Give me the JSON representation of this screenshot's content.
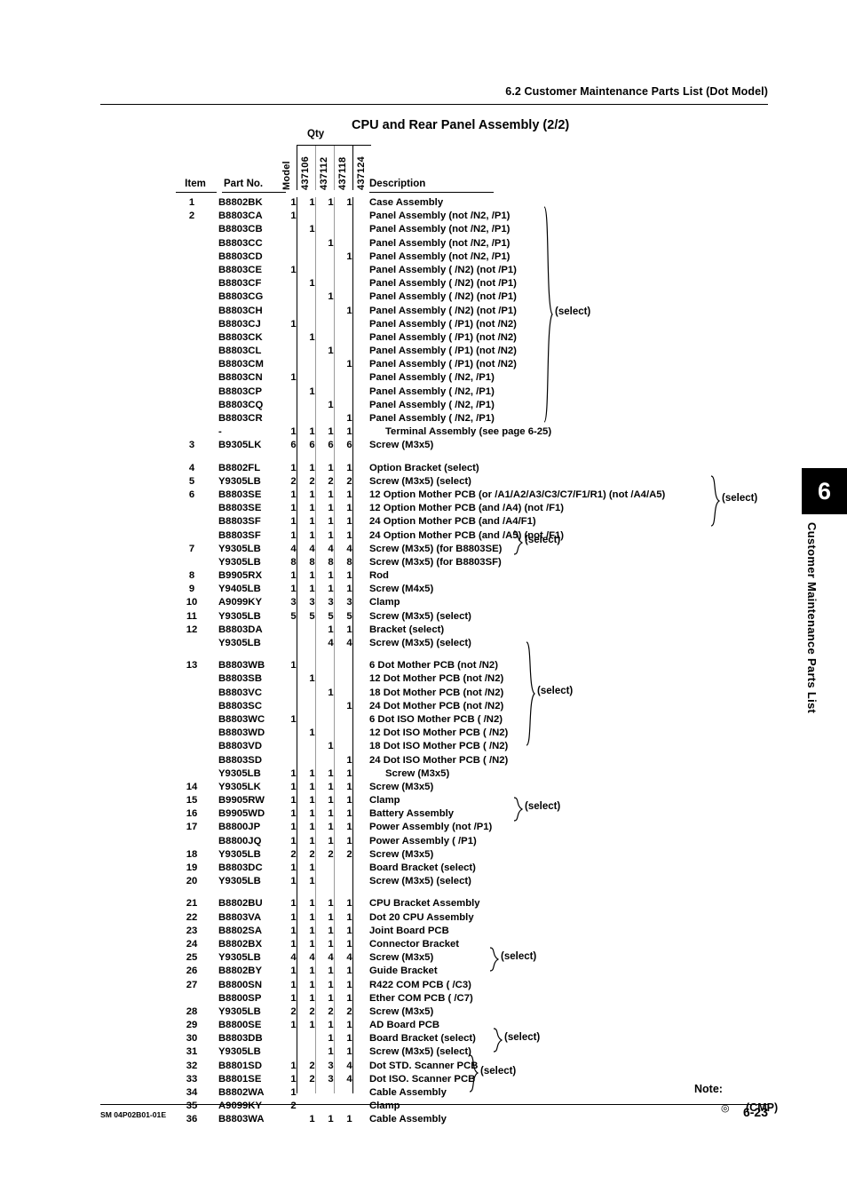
{
  "header": {
    "running_head": "6.2  Customer Maintenance Parts List (Dot Model)"
  },
  "figure": {
    "title": "CPU and Rear Panel Assembly (2/2)",
    "qty_label": "Qty"
  },
  "table": {
    "columns": {
      "item": "Item",
      "part_no": "Part  No.",
      "description": "Description",
      "model_label": "Model",
      "models": [
        "437106",
        "437112",
        "437118",
        "437124"
      ]
    },
    "rows": [
      {
        "item": "1",
        "part": "B8802BK",
        "q": [
          "1",
          "1",
          "1",
          "1"
        ],
        "desc": "Case Assembly"
      },
      {
        "item": "2",
        "part": "B8803CA",
        "q": [
          "1",
          "",
          "",
          ""
        ],
        "desc": "Panel Assembly (not /N2, /P1)"
      },
      {
        "item": "",
        "part": "B8803CB",
        "q": [
          "",
          "1",
          "",
          ""
        ],
        "desc": "Panel Assembly (not /N2, /P1)"
      },
      {
        "item": "",
        "part": "B8803CC",
        "q": [
          "",
          "",
          "1",
          ""
        ],
        "desc": "Panel Assembly (not /N2, /P1)"
      },
      {
        "item": "",
        "part": "B8803CD",
        "q": [
          "",
          "",
          "",
          "1"
        ],
        "desc": "Panel Assembly (not /N2, /P1)"
      },
      {
        "item": "",
        "part": "B8803CE",
        "q": [
          "1",
          "",
          "",
          ""
        ],
        "desc": "Panel Assembly ( /N2) (not /P1)"
      },
      {
        "item": "",
        "part": "B8803CF",
        "q": [
          "",
          "1",
          "",
          ""
        ],
        "desc": "Panel Assembly ( /N2) (not /P1)"
      },
      {
        "item": "",
        "part": "B8803CG",
        "q": [
          "",
          "",
          "1",
          ""
        ],
        "desc": "Panel Assembly ( /N2) (not /P1)"
      },
      {
        "item": "",
        "part": "B8803CH",
        "q": [
          "",
          "",
          "",
          "1"
        ],
        "desc": "Panel Assembly ( /N2) (not /P1)"
      },
      {
        "item": "",
        "part": "B8803CJ",
        "q": [
          "1",
          "",
          "",
          ""
        ],
        "desc": "Panel Assembly ( /P1) (not /N2)"
      },
      {
        "item": "",
        "part": "B8803CK",
        "q": [
          "",
          "1",
          "",
          ""
        ],
        "desc": "Panel Assembly ( /P1) (not /N2)"
      },
      {
        "item": "",
        "part": "B8803CL",
        "q": [
          "",
          "",
          "1",
          ""
        ],
        "desc": "Panel Assembly ( /P1) (not /N2)"
      },
      {
        "item": "",
        "part": "B8803CM",
        "q": [
          "",
          "",
          "",
          "1"
        ],
        "desc": "Panel Assembly ( /P1) (not /N2)"
      },
      {
        "item": "",
        "part": "B8803CN",
        "q": [
          "1",
          "",
          "",
          ""
        ],
        "desc": "Panel Assembly ( /N2, /P1)"
      },
      {
        "item": "",
        "part": "B8803CP",
        "q": [
          "",
          "1",
          "",
          ""
        ],
        "desc": "Panel Assembly ( /N2, /P1)"
      },
      {
        "item": "",
        "part": "B8803CQ",
        "q": [
          "",
          "",
          "1",
          ""
        ],
        "desc": "Panel Assembly ( /N2, /P1)"
      },
      {
        "item": "",
        "part": "B8803CR",
        "q": [
          "",
          "",
          "",
          "1"
        ],
        "desc": "Panel Assembly ( /N2, /P1)"
      },
      {
        "item": "",
        "part": "-",
        "q": [
          "1",
          "1",
          "1",
          "1"
        ],
        "desc": "Terminal Assembly (see page 6-25)",
        "indent": true
      },
      {
        "item": "3",
        "part": "B9305LK",
        "q": [
          "6",
          "6",
          "6",
          "6"
        ],
        "desc": "Screw (M3x5)"
      },
      {
        "spacer": true
      },
      {
        "item": "4",
        "part": "B8802FL",
        "q": [
          "1",
          "1",
          "1",
          "1"
        ],
        "desc": "Option Bracket (select)"
      },
      {
        "item": "5",
        "part": "Y9305LB",
        "q": [
          "2",
          "2",
          "2",
          "2"
        ],
        "desc": "Screw (M3x5) (select)"
      },
      {
        "item": "6",
        "part": "B8803SE",
        "q": [
          "1",
          "1",
          "1",
          "1"
        ],
        "desc": "12 Option Mother PCB (or /A1/A2/A3/C3/C7/F1/R1) (not /A4/A5)"
      },
      {
        "item": "",
        "part": "B8803SE",
        "q": [
          "1",
          "1",
          "1",
          "1"
        ],
        "desc": "12 Option Mother PCB (and /A4) (not /F1)"
      },
      {
        "item": "",
        "part": "B8803SF",
        "q": [
          "1",
          "1",
          "1",
          "1"
        ],
        "desc": "24 Option Mother PCB (and /A4/F1)"
      },
      {
        "item": "",
        "part": "B8803SF",
        "q": [
          "1",
          "1",
          "1",
          "1"
        ],
        "desc": "24 Option Mother PCB (and /A5) (not /F1)"
      },
      {
        "item": "7",
        "part": "Y9305LB",
        "q": [
          "4",
          "4",
          "4",
          "4"
        ],
        "desc": "Screw (M3x5) (for B8803SE)"
      },
      {
        "item": "",
        "part": "Y9305LB",
        "q": [
          "8",
          "8",
          "8",
          "8"
        ],
        "desc": "Screw (M3x5) (for B8803SF)"
      },
      {
        "item": "8",
        "part": "B9905RX",
        "q": [
          "1",
          "1",
          "1",
          "1"
        ],
        "desc": "Rod"
      },
      {
        "item": "9",
        "part": "Y9405LB",
        "q": [
          "1",
          "1",
          "1",
          "1"
        ],
        "desc": "Screw (M4x5)"
      },
      {
        "item": "10",
        "part": "A9099KY",
        "q": [
          "3",
          "3",
          "3",
          "3"
        ],
        "desc": "Clamp"
      },
      {
        "item": "11",
        "part": "Y9305LB",
        "q": [
          "5",
          "5",
          "5",
          "5"
        ],
        "desc": "Screw (M3x5) (select)"
      },
      {
        "item": "12",
        "part": "B8803DA",
        "q": [
          "",
          "",
          "1",
          "1"
        ],
        "desc": "Bracket (select)"
      },
      {
        "item": "",
        "part": "Y9305LB",
        "q": [
          "",
          "",
          "4",
          "4"
        ],
        "desc": "Screw (M3x5) (select)"
      },
      {
        "spacer": true
      },
      {
        "item": "13",
        "part": "B8803WB",
        "q": [
          "1",
          "",
          "",
          ""
        ],
        "desc": "6 Dot Mother PCB (not /N2)"
      },
      {
        "item": "",
        "part": "B8803SB",
        "q": [
          "",
          "1",
          "",
          ""
        ],
        "desc": "12 Dot Mother PCB (not /N2)"
      },
      {
        "item": "",
        "part": "B8803VC",
        "q": [
          "",
          "",
          "1",
          ""
        ],
        "desc": "18 Dot Mother PCB (not /N2)"
      },
      {
        "item": "",
        "part": "B8803SC",
        "q": [
          "",
          "",
          "",
          "1"
        ],
        "desc": "24 Dot Mother PCB (not /N2)"
      },
      {
        "item": "",
        "part": "B8803WC",
        "q": [
          "1",
          "",
          "",
          ""
        ],
        "desc": "6 Dot ISO Mother PCB ( /N2)"
      },
      {
        "item": "",
        "part": "B8803WD",
        "q": [
          "",
          "1",
          "",
          ""
        ],
        "desc": "12 Dot ISO Mother PCB ( /N2)"
      },
      {
        "item": "",
        "part": "B8803VD",
        "q": [
          "",
          "",
          "1",
          ""
        ],
        "desc": "18 Dot ISO Mother PCB ( /N2)"
      },
      {
        "item": "",
        "part": "B8803SD",
        "q": [
          "",
          "",
          "",
          "1"
        ],
        "desc": "24 Dot ISO Mother PCB ( /N2)"
      },
      {
        "item": "",
        "part": "Y9305LB",
        "q": [
          "1",
          "1",
          "1",
          "1"
        ],
        "desc": "Screw (M3x5)",
        "indent": true
      },
      {
        "item": "14",
        "part": "Y9305LK",
        "q": [
          "1",
          "1",
          "1",
          "1"
        ],
        "desc": "Screw (M3x5)"
      },
      {
        "item": "15",
        "part": "B9905RW",
        "q": [
          "1",
          "1",
          "1",
          "1"
        ],
        "desc": "Clamp"
      },
      {
        "item": "16",
        "part": "B9905WD",
        "q": [
          "1",
          "1",
          "1",
          "1"
        ],
        "desc": "Battery Assembly"
      },
      {
        "item": "17",
        "part": "B8800JP",
        "q": [
          "1",
          "1",
          "1",
          "1"
        ],
        "desc": "Power Assembly (not /P1)"
      },
      {
        "item": "",
        "part": "B8800JQ",
        "q": [
          "1",
          "1",
          "1",
          "1"
        ],
        "desc": "Power Assembly ( /P1)"
      },
      {
        "item": "18",
        "part": "Y9305LB",
        "q": [
          "2",
          "2",
          "2",
          "2"
        ],
        "desc": "Screw (M3x5)"
      },
      {
        "item": "19",
        "part": "B8803DC",
        "q": [
          "1",
          "1",
          "",
          ""
        ],
        "desc": "Board Bracket (select)"
      },
      {
        "item": "20",
        "part": "Y9305LB",
        "q": [
          "1",
          "1",
          "",
          ""
        ],
        "desc": "Screw (M3x5) (select)"
      },
      {
        "spacer": true
      },
      {
        "item": "21",
        "part": "B8802BU",
        "q": [
          "1",
          "1",
          "1",
          "1"
        ],
        "desc": "CPU Bracket Assembly"
      },
      {
        "item": "22",
        "part": "B8803VA",
        "q": [
          "1",
          "1",
          "1",
          "1"
        ],
        "desc": "Dot 20 CPU Assembly"
      },
      {
        "item": "23",
        "part": "B8802SA",
        "q": [
          "1",
          "1",
          "1",
          "1"
        ],
        "desc": "Joint Board PCB"
      },
      {
        "item": "24",
        "part": "B8802BX",
        "q": [
          "1",
          "1",
          "1",
          "1"
        ],
        "desc": "Connector Bracket"
      },
      {
        "item": "25",
        "part": "Y9305LB",
        "q": [
          "4",
          "4",
          "4",
          "4"
        ],
        "desc": "Screw (M3x5)"
      },
      {
        "item": "26",
        "part": "B8802BY",
        "q": [
          "1",
          "1",
          "1",
          "1"
        ],
        "desc": "Guide Bracket"
      },
      {
        "item": "27",
        "part": "B8800SN",
        "q": [
          "1",
          "1",
          "1",
          "1"
        ],
        "desc": "R422 COM PCB ( /C3)"
      },
      {
        "item": "",
        "part": "B8800SP",
        "q": [
          "1",
          "1",
          "1",
          "1"
        ],
        "desc": "Ether COM PCB ( /C7)"
      },
      {
        "item": "28",
        "part": "Y9305LB",
        "q": [
          "2",
          "2",
          "2",
          "2"
        ],
        "desc": "Screw (M3x5)"
      },
      {
        "item": "29",
        "part": "B8800SE",
        "q": [
          "1",
          "1",
          "1",
          "1"
        ],
        "desc": "AD Board PCB"
      },
      {
        "item": "30",
        "part": "B8803DB",
        "q": [
          "",
          "",
          "1",
          "1"
        ],
        "desc": "Board Bracket (select)"
      },
      {
        "item": "31",
        "part": "Y9305LB",
        "q": [
          "",
          "",
          "1",
          "1"
        ],
        "desc": "Screw (M3x5) (select)"
      },
      {
        "item": "32",
        "part": "B8801SD",
        "q": [
          "1",
          "2",
          "3",
          "4"
        ],
        "desc": "Dot STD. Scanner PCB"
      },
      {
        "item": "33",
        "part": "B8801SE",
        "q": [
          "1",
          "2",
          "3",
          "4"
        ],
        "desc": "Dot ISO. Scanner PCB"
      },
      {
        "item": "34",
        "part": "B8802WA",
        "q": [
          "1",
          "",
          "",
          ""
        ],
        "desc": "Cable Assembly"
      },
      {
        "item": "35",
        "part": "A9099KY",
        "q": [
          "2",
          "",
          "",
          ""
        ],
        "desc": "Clamp"
      },
      {
        "item": "36",
        "part": "B8803WA",
        "q": [
          "",
          "1",
          "1",
          "1"
        ],
        "desc": "Cable Assembly"
      }
    ],
    "select_label": "(select)"
  },
  "note": {
    "title": "Note:",
    "symbol": "◎",
    "text": "(CMP)"
  },
  "side_tab": {
    "number": "6",
    "label": "Customer Maintenance Parts List"
  },
  "footer": {
    "doc_code": "SM 04P02B01-01E",
    "page": "6-23"
  }
}
